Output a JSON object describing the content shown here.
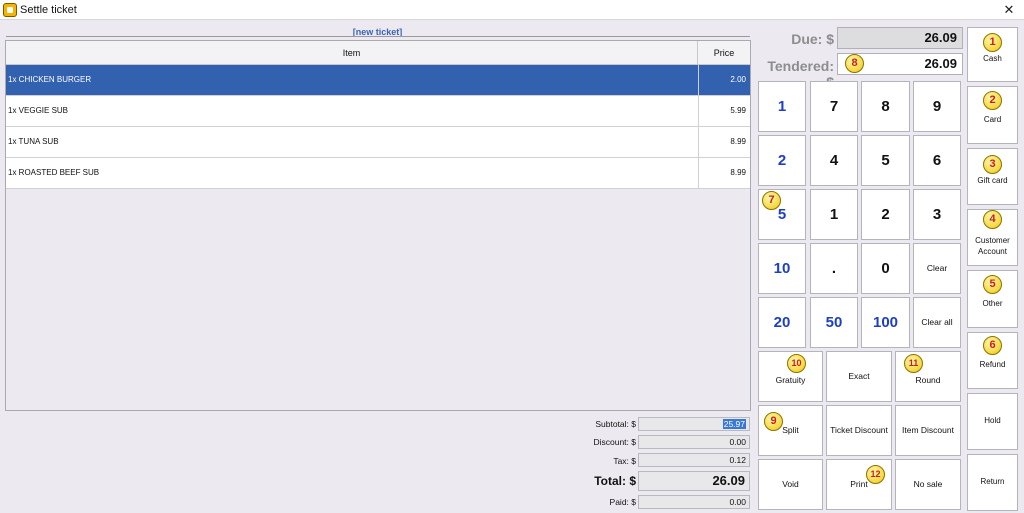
{
  "window": {
    "title": "Settle ticket",
    "close_glyph": "✕",
    "icon": "app-logo-icon"
  },
  "ticket": {
    "label": "[new ticket]",
    "columns": {
      "item": "Item",
      "price": "Price"
    },
    "rows": [
      {
        "item": "1x CHICKEN BURGER",
        "price": "2.00",
        "selected": true
      },
      {
        "item": "1x VEGGIE SUB",
        "price": "5.99",
        "selected": false
      },
      {
        "item": "1x TUNA SUB",
        "price": "8.99",
        "selected": false
      },
      {
        "item": "1x ROASTED BEEF SUB",
        "price": "8.99",
        "selected": false
      }
    ]
  },
  "summary": {
    "subtotal_label": "Subtotal: $",
    "subtotal": "25.97",
    "discount_label": "Discount: $",
    "discount": "0.00",
    "tax_label": "Tax: $",
    "tax": "0.12",
    "total_label": "Total: $",
    "total": "26.09",
    "paid_label": "Paid: $",
    "paid": "0.00"
  },
  "amounts": {
    "due_label": "Due: $",
    "due": "26.09",
    "tendered_label": "Tendered: $",
    "tendered": "26.09"
  },
  "keypad": {
    "r1": [
      "1",
      "7",
      "8",
      "9"
    ],
    "r2": [
      "2",
      "4",
      "5",
      "6"
    ],
    "r3": [
      "5",
      "1",
      "2",
      "3"
    ],
    "r4": [
      "10",
      ".",
      "0",
      "Clear"
    ],
    "r5": [
      "20",
      "50",
      "100",
      "Clear all"
    ]
  },
  "actions": {
    "gratuity": "Gratuity",
    "exact": "Exact",
    "round": "Round",
    "split": "Split",
    "ticket_discount": "Ticket Discount",
    "item_discount": "Item Discount",
    "void": "Void",
    "print": "Print",
    "no_sale": "No sale"
  },
  "payment_methods": {
    "cash": "Cash",
    "card": "Card",
    "gift_card": "Gift card",
    "customer_account": "Customer Account",
    "other": "Other",
    "refund": "Refund",
    "hold": "Hold",
    "return": "Return"
  },
  "badges": [
    "1",
    "2",
    "3",
    "4",
    "5",
    "6",
    "7",
    "8",
    "9",
    "10",
    "11",
    "12"
  ],
  "colors": {
    "selection": "#3261b0",
    "keypad_blue": "#1d3fc7",
    "badge_text": "#d11a1a",
    "ticket_label": "#3a62b8"
  }
}
